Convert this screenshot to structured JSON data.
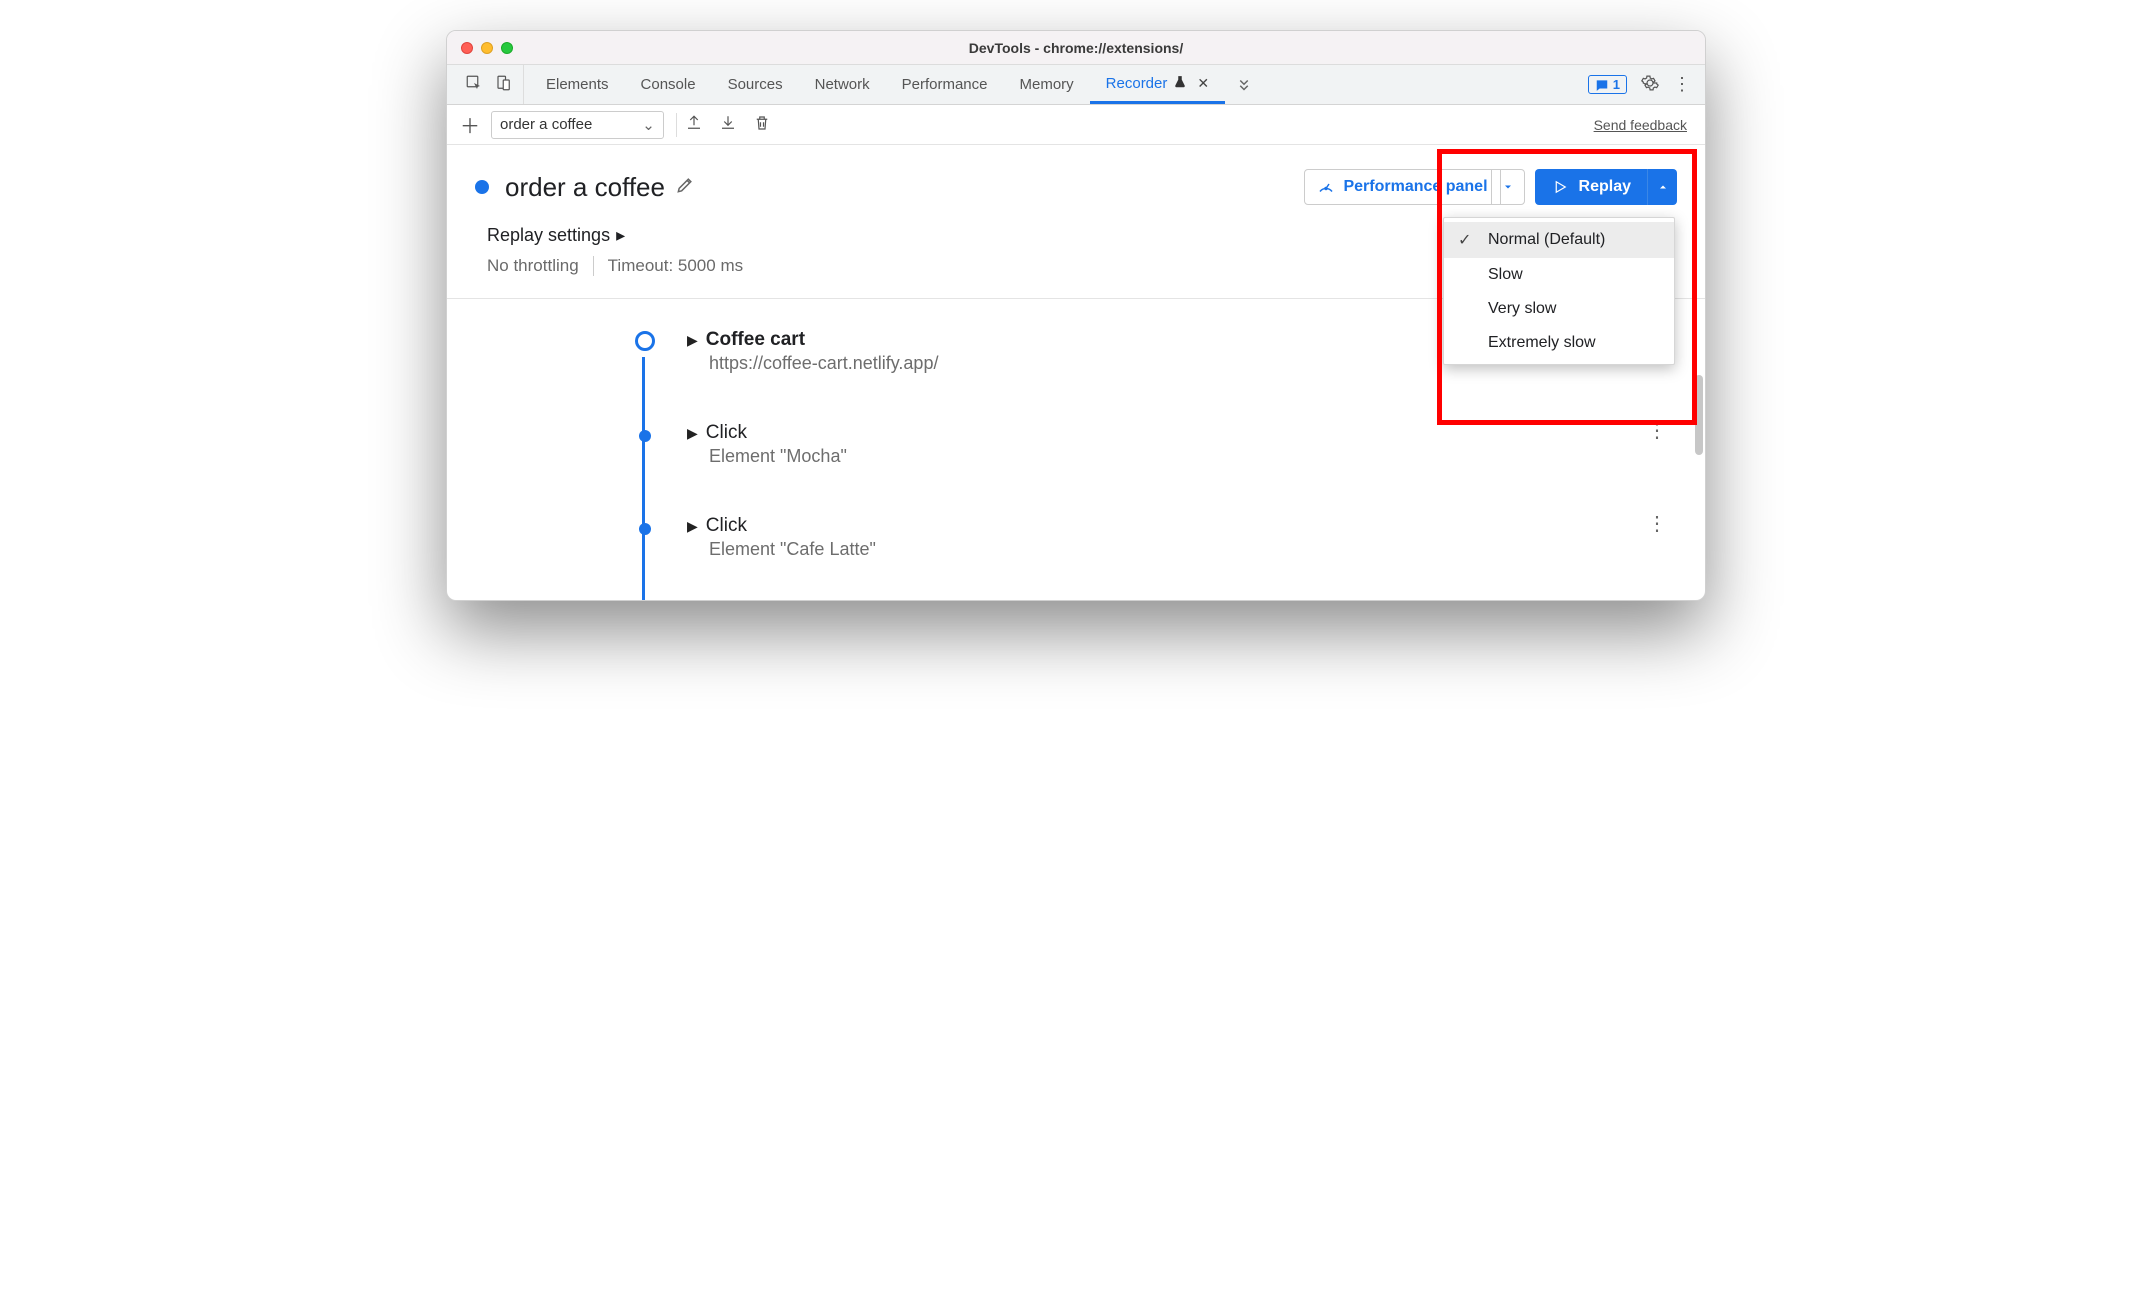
{
  "window": {
    "title": "DevTools - chrome://extensions/"
  },
  "tabs": {
    "items": [
      "Elements",
      "Console",
      "Sources",
      "Network",
      "Performance",
      "Memory"
    ],
    "active": "Recorder",
    "badge_count": "1"
  },
  "toolbar": {
    "recording_name": "order a coffee",
    "feedback": "Send feedback"
  },
  "recording": {
    "title": "order a coffee",
    "perf_label": "Performance panel",
    "replay_label": "Replay"
  },
  "settings": {
    "heading": "Replay settings",
    "throttling": "No throttling",
    "timeout": "Timeout: 5000 ms"
  },
  "menu": {
    "items": [
      "Normal (Default)",
      "Slow",
      "Very slow",
      "Extremely slow"
    ],
    "selected_index": 0
  },
  "steps": [
    {
      "title": "Coffee cart",
      "subtitle": "https://coffee-cart.netlify.app/",
      "bold": true,
      "first": true
    },
    {
      "title": "Click",
      "subtitle": "Element \"Mocha\"",
      "bold": false,
      "first": false
    },
    {
      "title": "Click",
      "subtitle": "Element \"Cafe Latte\"",
      "bold": false,
      "first": false
    }
  ]
}
